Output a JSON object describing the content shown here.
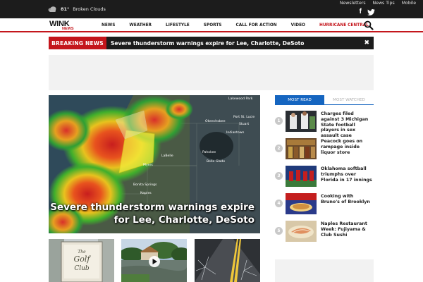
{
  "weather": {
    "temp": "81°",
    "condition": "Broken Clouds",
    "icon": "cloud-icon"
  },
  "top_links": [
    "Newsletters",
    "News Tips",
    "Mobile"
  ],
  "social": {
    "facebook_glyph": "f",
    "twitter_icon": "twitter-icon"
  },
  "logo": {
    "line1": "WINK",
    "line2": "NEWS"
  },
  "nav": {
    "items": [
      "NEWS",
      "WEATHER",
      "LIFESTYLE",
      "SPORTS",
      "CALL FOR ACTION",
      "VIDEO",
      "HURRICANE CENTRAL"
    ],
    "search_icon": "search-icon"
  },
  "breaking": {
    "tag": "BREAKING NEWS",
    "message": "Severe thunderstorm warnings expire for Lee, Charlotte, DeSoto",
    "close_glyph": "✖"
  },
  "hero": {
    "headline": "Severe thunderstorm warnings expire for Lee, Charlotte, DeSoto",
    "map_labels": [
      "Lakewood Park",
      "Port St. Lucie",
      "Stuart",
      "Okeechobee",
      "Indiantown",
      "Pahokee",
      "Belle Glade",
      "LaBelle",
      "Myers",
      "Bonita Springs",
      "Naples"
    ]
  },
  "thumbs": [
    {
      "sign_line1": "The",
      "sign_line2": "Golf",
      "sign_line3": "Club"
    },
    {
      "play_icon": "play-icon"
    },
    {}
  ],
  "sidebar": {
    "tabs": [
      "MOST READ",
      "MOST WATCHED"
    ],
    "items": [
      {
        "num": "1",
        "title": "Charges filed against 3 Michigan State football players in sex assault case"
      },
      {
        "num": "2",
        "title": "Peacock goes on rampage inside liquor store"
      },
      {
        "num": "3",
        "title": "Oklahoma softball triumphs over Florida in 17 innings"
      },
      {
        "num": "4",
        "title": "Cooking with Bruno's of Brooklyn"
      },
      {
        "num": "5",
        "title": "Naples Restaurant Week: Fujiyama & Club Sushi"
      }
    ]
  },
  "colors": {
    "brand_red": "#c4161c",
    "tab_blue": "#1565c0",
    "dark_bar": "#1c1c1c"
  }
}
